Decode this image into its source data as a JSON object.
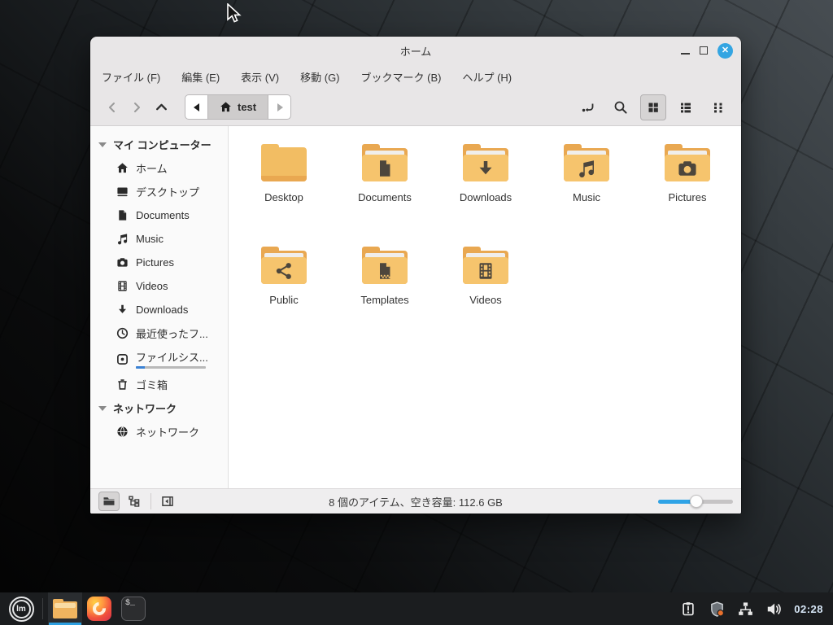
{
  "window": {
    "title": "ホーム",
    "controls": {
      "close_glyph": "✕"
    },
    "menubar": {
      "items": [
        {
          "label": "ファイル (F)"
        },
        {
          "label": "編集 (E)"
        },
        {
          "label": "表示 (V)"
        },
        {
          "label": "移動 (G)"
        },
        {
          "label": "ブックマーク (B)"
        },
        {
          "label": "ヘルプ (H)"
        }
      ]
    },
    "toolbar": {
      "breadcrumb_current": "test"
    },
    "sidebar": {
      "sections": [
        {
          "label": "マイ コンピューター",
          "items": [
            {
              "icon": "home-icon",
              "label": "ホーム"
            },
            {
              "icon": "desktop-icon",
              "label": "デスクトップ"
            },
            {
              "icon": "document-icon",
              "label": "Documents"
            },
            {
              "icon": "music-icon",
              "label": "Music"
            },
            {
              "icon": "camera-icon",
              "label": "Pictures"
            },
            {
              "icon": "film-icon",
              "label": "Videos"
            },
            {
              "icon": "download-icon",
              "label": "Downloads"
            },
            {
              "icon": "clock-icon",
              "label": "最近使ったフ..."
            },
            {
              "icon": "disk-icon",
              "label": "ファイルシス...",
              "disk_usage_percent": 13
            },
            {
              "icon": "trash-icon",
              "label": "ゴミ箱"
            }
          ]
        },
        {
          "label": "ネットワーク",
          "items": [
            {
              "icon": "globe-icon",
              "label": "ネットワーク"
            }
          ]
        }
      ]
    },
    "files": [
      {
        "label": "Desktop",
        "icon": "folder-plain"
      },
      {
        "label": "Documents",
        "icon": "folder-document"
      },
      {
        "label": "Downloads",
        "icon": "folder-download"
      },
      {
        "label": "Music",
        "icon": "folder-music"
      },
      {
        "label": "Pictures",
        "icon": "folder-camera"
      },
      {
        "label": "Public",
        "icon": "folder-share"
      },
      {
        "label": "Templates",
        "icon": "folder-template"
      },
      {
        "label": "Videos",
        "icon": "folder-film"
      }
    ],
    "statusbar": {
      "text": "8 個のアイテム、空き容量: 112.6 GB",
      "zoom_percent": 51
    }
  },
  "taskbar": {
    "terminal_glyph": "$_",
    "mint_logo_text": "lm",
    "clock": "02:28"
  },
  "colors": {
    "accent_blue": "#34a5e2",
    "folder_light": "#f6c46d",
    "folder_dark": "#e9a851",
    "taskbar_bg": "#1b1d1f"
  }
}
